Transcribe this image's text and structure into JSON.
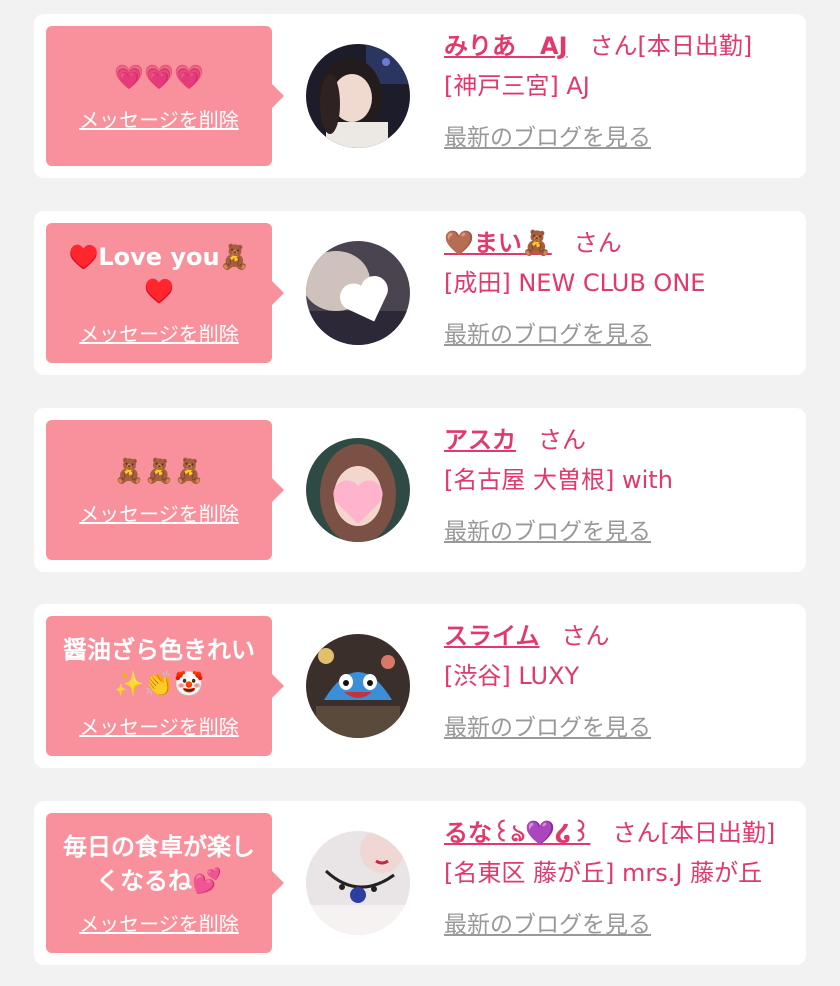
{
  "accent_color": "#e2386c",
  "bubble_color": "#f8919b",
  "cards": [
    {
      "message": "💗💗💗",
      "delete_label": "メッセージを削除",
      "name": "みりあ　AJ",
      "honorific": "さん",
      "status": "[本日出勤]",
      "shop": "[神戸三宮] AJ",
      "blog_link": "最新のブログを見る",
      "avatar": "selfie-photo"
    },
    {
      "message": "♥️Love you🧸♥️",
      "delete_label": "メッセージを削除",
      "name": "🤎まい🧸",
      "honorific": "さん",
      "status": "",
      "shop": "[成田] NEW CLUB ONE",
      "blog_link": "最新のブログを見る",
      "avatar": "secret-heart-photo"
    },
    {
      "message": "🧸🧸🧸",
      "delete_label": "メッセージを削除",
      "name": "アスカ",
      "honorific": "さん",
      "status": "",
      "shop": "[名古屋 大曽根] with",
      "blog_link": "最新のブログを見る",
      "avatar": "heart-face-photo"
    },
    {
      "message": "醤油ざら色きれい✨👏🤡",
      "delete_label": "メッセージを削除",
      "name": "スライム",
      "honorific": "さん",
      "status": "",
      "shop": "[渋谷] LUXY",
      "blog_link": "最新のブログを見る",
      "avatar": "slime-mask-photo"
    },
    {
      "message": "毎日の食卓が楽しくなるね💕",
      "delete_label": "メッセージを削除",
      "name": "るな꒰ঌ💜໒꒱",
      "honorific": "さん",
      "status": "[本日出勤]",
      "shop": "[名東区 藤が丘] mrs.J 藤が丘",
      "blog_link": "最新のブログを見る",
      "avatar": "necklace-photo"
    }
  ]
}
